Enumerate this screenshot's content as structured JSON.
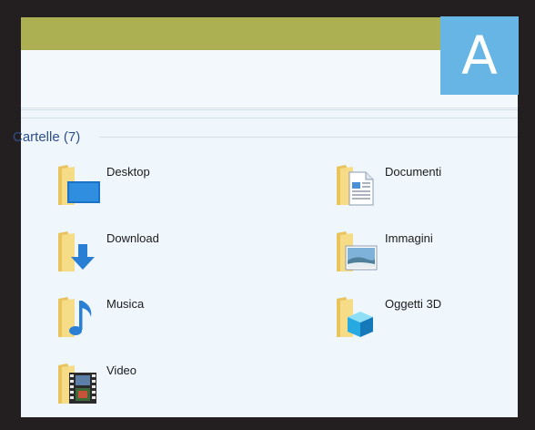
{
  "badge": {
    "letter": "A"
  },
  "group": {
    "title": "Cartelle (7)"
  },
  "folders": [
    {
      "label": "Desktop",
      "icon": "desktop-folder-icon"
    },
    {
      "label": "Documenti",
      "icon": "documents-folder-icon"
    },
    {
      "label": "Download",
      "icon": "download-folder-icon"
    },
    {
      "label": "Immagini",
      "icon": "pictures-folder-icon"
    },
    {
      "label": "Musica",
      "icon": "music-folder-icon"
    },
    {
      "label": "Oggetti 3D",
      "icon": "3d-objects-folder-icon"
    },
    {
      "label": "Video",
      "icon": "video-folder-icon"
    }
  ],
  "colors": {
    "titlebar": "#acb052",
    "badge": "#66b5e4",
    "group_title": "#2e4f8b",
    "folder": "#f4d57a"
  }
}
